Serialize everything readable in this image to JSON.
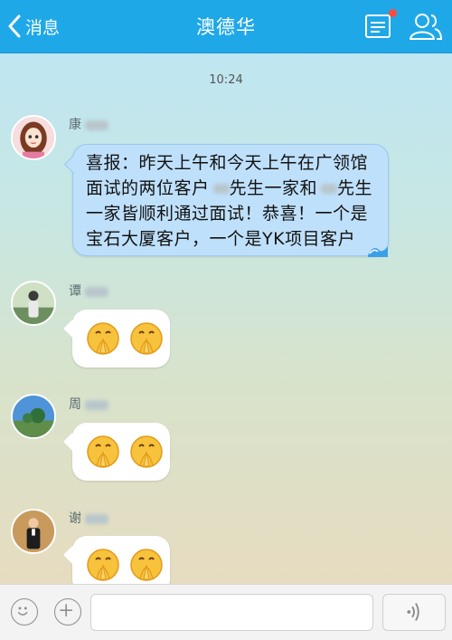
{
  "header": {
    "back_label": "消息",
    "title": "澳德华"
  },
  "chat": {
    "timestamp": "10:24",
    "messages": [
      {
        "sender": "康",
        "type": "text",
        "text_lines": [
          "喜报：昨天上午和今天上午在广领馆",
          "面试的两位客户",
          "先生一家和",
          "先生",
          "一家皆顺利通过面试！恭喜！一个是",
          "宝石大厦客户，一个是YK项目客户"
        ]
      },
      {
        "sender": "谭",
        "type": "emoji",
        "emoji": [
          "praying-face",
          "praying-face"
        ]
      },
      {
        "sender": "周",
        "type": "emoji",
        "emoji": [
          "praying-face",
          "praying-face"
        ]
      },
      {
        "sender": "谢",
        "type": "emoji",
        "emoji": [
          "praying-face",
          "praying-face"
        ]
      }
    ]
  },
  "colors": {
    "header_bg": "#1fa8e8",
    "bubble_highlight": "#bfe0fb",
    "notification_dot": "#ff4b3a"
  }
}
